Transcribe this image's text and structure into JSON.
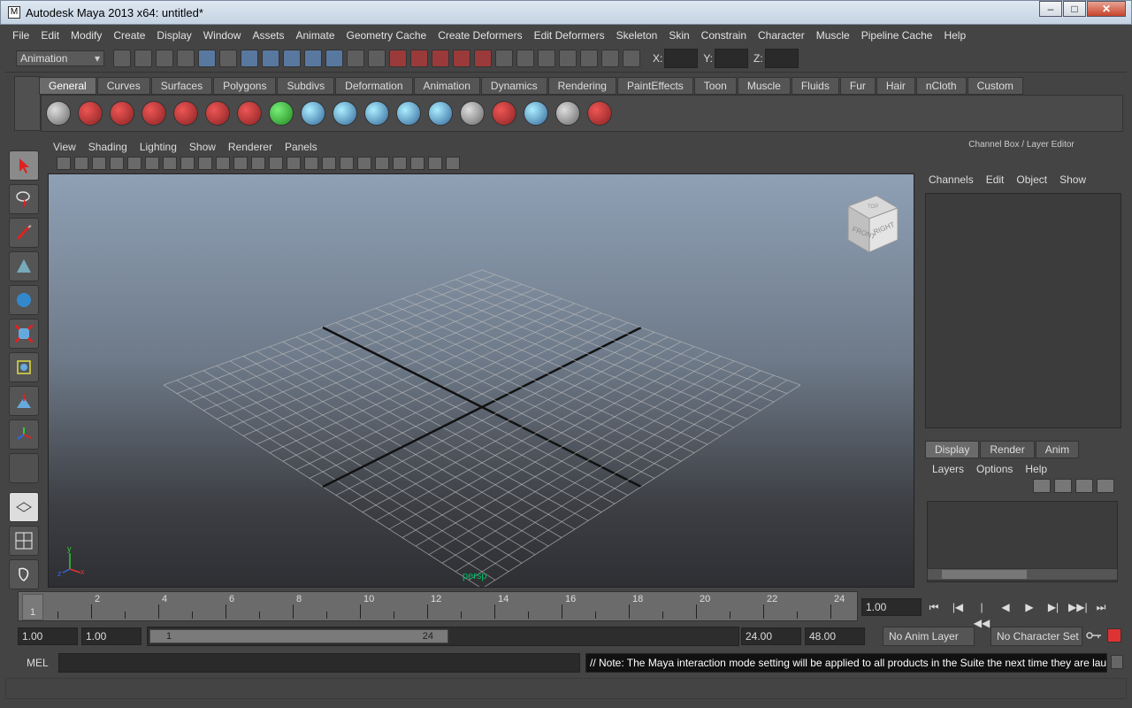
{
  "window": {
    "title": "Autodesk Maya 2013 x64: untitled*",
    "minimize": "–",
    "maximize": "□",
    "close": "✕"
  },
  "menubar": [
    "File",
    "Edit",
    "Modify",
    "Create",
    "Display",
    "Window",
    "Assets",
    "Animate",
    "Geometry Cache",
    "Create Deformers",
    "Edit Deformers",
    "Skeleton",
    "Skin",
    "Constrain",
    "Character",
    "Muscle",
    "Pipeline Cache",
    "Help"
  ],
  "status_line": {
    "mode": "Animation",
    "x_label": "X:",
    "y_label": "Y:",
    "z_label": "Z:"
  },
  "shelf": {
    "tabs": [
      "General",
      "Curves",
      "Surfaces",
      "Polygons",
      "Subdivs",
      "Deformation",
      "Animation",
      "Dynamics",
      "Rendering",
      "PaintEffects",
      "Toon",
      "Muscle",
      "Fluids",
      "Fur",
      "Hair",
      "nCloth",
      "Custom"
    ],
    "active_tab": "General",
    "icons": [
      "film-reel",
      "help",
      "camera",
      "camera-aim",
      "camera-aim-up",
      "stereo-camera",
      "curve-tool",
      "rotate-arrow",
      "sphere-delete",
      "joint",
      "ik-handle",
      "cluster",
      "lattice",
      "outliner",
      "render-object",
      "render-sphere",
      "cube-grid",
      "paint-brush"
    ]
  },
  "toolbox": [
    "select-tool",
    "lasso-tool",
    "paint-select-tool",
    "move-tool",
    "rotate-tool",
    "scale-tool",
    "universal-manipulator",
    "soft-mod-tool",
    "show-manipulator",
    "last-used-tool",
    "single-perspective-layout",
    "four-view-layout",
    "outliner-layout"
  ],
  "viewport": {
    "menu": [
      "View",
      "Shading",
      "Lighting",
      "Show",
      "Renderer",
      "Panels"
    ],
    "camera_label": "persp",
    "viewcube": {
      "front": "FRONT",
      "right": "RIGHT",
      "top": "TOP"
    },
    "axis": {
      "x": "x",
      "y": "y",
      "z": "z"
    }
  },
  "channel_box": {
    "title": "Channel Box / Layer Editor",
    "menu": [
      "Channels",
      "Edit",
      "Object",
      "Show"
    ]
  },
  "layer_editor": {
    "tabs": [
      "Display",
      "Render",
      "Anim"
    ],
    "active_tab": "Display",
    "menu": [
      "Layers",
      "Options",
      "Help"
    ]
  },
  "time_slider": {
    "current_frame": "1",
    "tick_labels": [
      "2",
      "4",
      "6",
      "8",
      "10",
      "12",
      "14",
      "16",
      "18",
      "20",
      "22",
      "24"
    ],
    "current_time": "1.00"
  },
  "range_slider": {
    "start_time": "1.00",
    "playback_start": "1.00",
    "range_start": "1",
    "range_end": "24",
    "playback_end": "24.00",
    "end_time": "48.00",
    "anim_layer": "No Anim Layer",
    "character_set": "No Character Set"
  },
  "playback": [
    "⏮",
    "|◀",
    "|◀◀",
    "◀",
    "▶",
    "▶|",
    "▶▶|",
    "⏭"
  ],
  "command_line": {
    "label": "MEL",
    "feedback": "// Note: The Maya interaction mode setting will be applied to all products in the Suite the next time they are launched. //"
  },
  "colors": {
    "panel": "#444444",
    "viewport_top": "#8fa0b5",
    "viewport_bottom": "#2e2f33",
    "grid": "#b8b8b8",
    "axis_line": "#111111"
  }
}
